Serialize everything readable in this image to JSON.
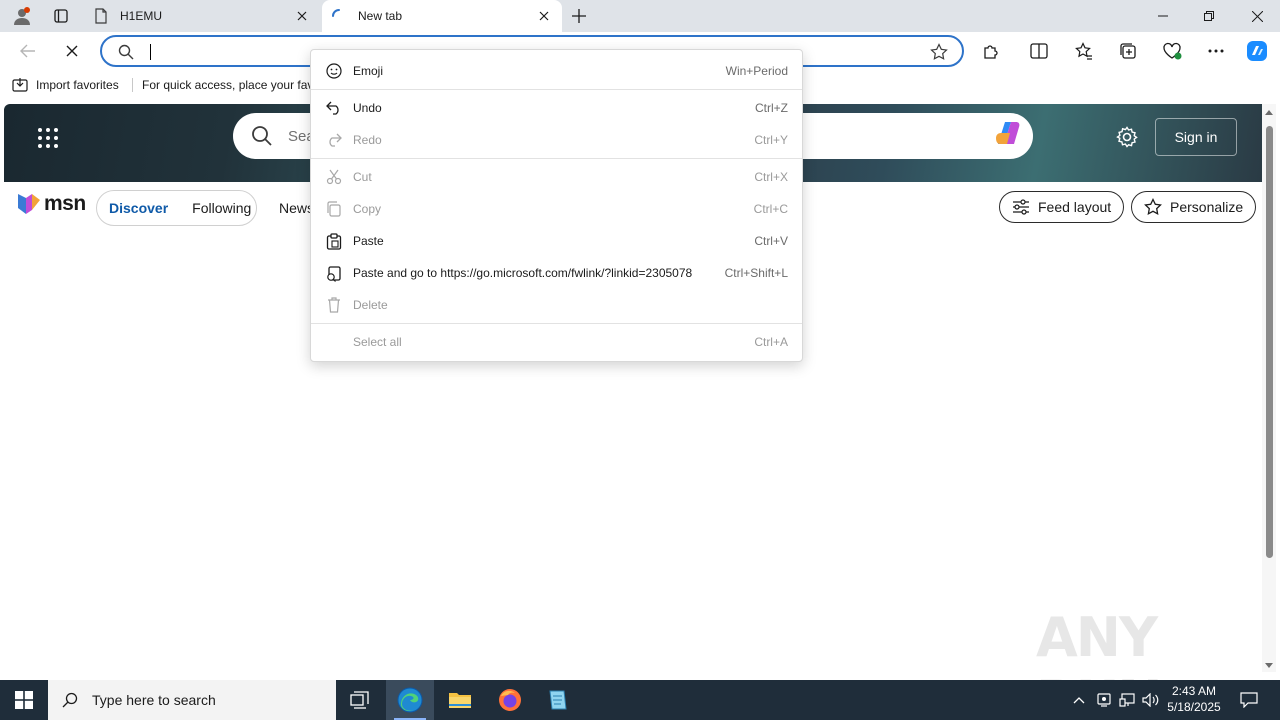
{
  "tabs": [
    {
      "title": "H1EMU"
    },
    {
      "title": "New tab"
    }
  ],
  "address": {
    "value": ""
  },
  "favorites": {
    "import_label": "Import favorites",
    "hint": "For quick access, place your fav"
  },
  "msn": {
    "search_placeholder": "Sea",
    "signin_label": "Sign in",
    "logo_text": "msn",
    "tabs": [
      "Discover",
      "Following"
    ],
    "news_label": "News",
    "feed_layout_label": "Feed layout",
    "personalize_label": "Personalize"
  },
  "context_menu": {
    "items": [
      {
        "label": "Emoji",
        "shortcut": "Win+Period",
        "icon": "emoji-icon",
        "enabled": true
      },
      {
        "label": "Undo",
        "shortcut": "Ctrl+Z",
        "icon": "undo-icon",
        "enabled": true
      },
      {
        "label": "Redo",
        "shortcut": "Ctrl+Y",
        "icon": "redo-icon",
        "enabled": false
      },
      {
        "label": "Cut",
        "shortcut": "Ctrl+X",
        "icon": "cut-icon",
        "enabled": false
      },
      {
        "label": "Copy",
        "shortcut": "Ctrl+C",
        "icon": "copy-icon",
        "enabled": false
      },
      {
        "label": "Paste",
        "shortcut": "Ctrl+V",
        "icon": "paste-icon",
        "enabled": true
      },
      {
        "label": "Paste and go to https://go.microsoft.com/fwlink/?linkid=2305078",
        "shortcut": "Ctrl+Shift+L",
        "icon": "paste-go-icon",
        "enabled": true
      },
      {
        "label": "Delete",
        "shortcut": "",
        "icon": "delete-icon",
        "enabled": false
      },
      {
        "label": "Select all",
        "shortcut": "Ctrl+A",
        "icon": "",
        "enabled": false
      }
    ]
  },
  "taskbar": {
    "search_placeholder": "Type here to search",
    "time": "2:43 AM",
    "date": "5/18/2025"
  },
  "watermark": "ANY RUN",
  "colors": {
    "accent": "#2e73c9",
    "msn_active_tab": "#0f5aa8",
    "taskbar": "#1f2d3a"
  }
}
